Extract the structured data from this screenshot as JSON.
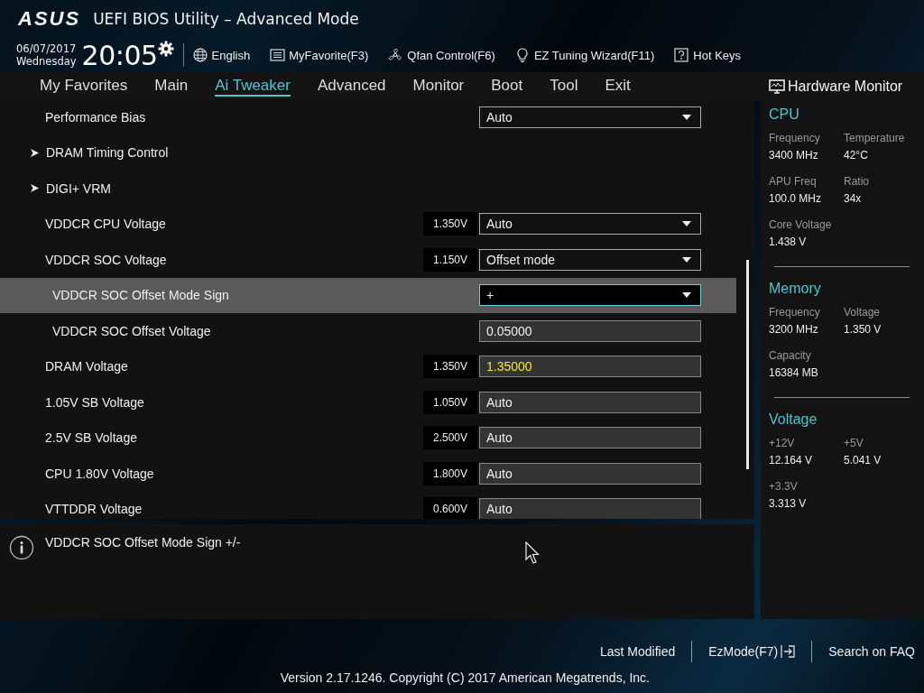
{
  "header": {
    "logo": "ASUS",
    "title": "UEFI BIOS Utility – Advanced Mode",
    "date": "06/07/2017",
    "weekday": "Wednesday",
    "time": "20:05",
    "tools": [
      {
        "kind": "language",
        "label": "English"
      },
      {
        "kind": "favorites",
        "label": "MyFavorite(F3)"
      },
      {
        "kind": "fan",
        "label": "Qfan Control(F6)"
      },
      {
        "kind": "wizard",
        "label": "EZ Tuning Wizard(F11)"
      },
      {
        "kind": "hotkeys",
        "label": "Hot Keys"
      }
    ]
  },
  "menu": [
    {
      "label": "My Favorites",
      "selected": false
    },
    {
      "label": "Main",
      "selected": false
    },
    {
      "label": "Ai Tweaker",
      "selected": true
    },
    {
      "label": "Advanced",
      "selected": false
    },
    {
      "label": "Monitor",
      "selected": false
    },
    {
      "label": "Boot",
      "selected": false
    },
    {
      "label": "Tool",
      "selected": false
    },
    {
      "label": "Exit",
      "selected": false
    }
  ],
  "settings": [
    {
      "kind": "dropdown",
      "label": "Performance Bias",
      "value": "Auto",
      "selected": false
    },
    {
      "kind": "submenu",
      "label": "DRAM Timing Control"
    },
    {
      "kind": "submenu",
      "label": "DIGI+ VRM"
    },
    {
      "kind": "dropdown",
      "label": "VDDCR CPU Voltage",
      "reading": "1.350V",
      "value": "Auto",
      "selected": false
    },
    {
      "kind": "dropdown",
      "label": "VDDCR SOC Voltage",
      "reading": "1.150V",
      "value": "Offset mode",
      "selected": false,
      "children": [
        {
          "kind": "dropdown",
          "label": "VDDCR SOC Offset Mode Sign",
          "value": "+",
          "selected": true
        },
        {
          "kind": "field",
          "label": "VDDCR SOC Offset Voltage",
          "value": "0.05000",
          "modified": false,
          "selected": false
        }
      ]
    },
    {
      "kind": "field",
      "label": "DRAM Voltage",
      "reading": "1.350V",
      "value": "1.35000",
      "modified": true,
      "selected": false
    },
    {
      "kind": "field",
      "label": "1.05V SB Voltage",
      "reading": "1.050V",
      "value": "Auto",
      "modified": false,
      "selected": false
    },
    {
      "kind": "field",
      "label": "2.5V SB Voltage",
      "reading": "2.500V",
      "value": "Auto",
      "modified": false,
      "selected": false
    },
    {
      "kind": "field",
      "label": "CPU 1.80V Voltage",
      "reading": "1.800V",
      "value": "Auto",
      "modified": false,
      "selected": false
    },
    {
      "kind": "field",
      "label": "VTTDDR Voltage",
      "reading": "0.600V",
      "value": "Auto",
      "modified": false,
      "selected": false
    }
  ],
  "help": "VDDCR SOC Offset Mode Sign +/-",
  "hardware_monitor": {
    "title": "Hardware Monitor",
    "sections": [
      {
        "title": "CPU",
        "items": [
          {
            "label": "Frequency",
            "value": "3400 MHz"
          },
          {
            "label": "Temperature",
            "value": "42°C"
          },
          {
            "label": "APU Freq",
            "value": "100.0 MHz"
          },
          {
            "label": "Ratio",
            "value": "34x"
          },
          {
            "label": "Core Voltage",
            "value": "1.438 V"
          }
        ]
      },
      {
        "title": "Memory",
        "items": [
          {
            "label": "Frequency",
            "value": "3200 MHz"
          },
          {
            "label": "Voltage",
            "value": "1.350 V"
          },
          {
            "label": "Capacity",
            "value": "16384 MB"
          }
        ]
      },
      {
        "title": "Voltage",
        "items": [
          {
            "label": "+12V",
            "value": "12.164 V"
          },
          {
            "label": "+5V",
            "value": "5.041 V"
          },
          {
            "label": "+3.3V",
            "value": "3.313 V"
          }
        ]
      }
    ]
  },
  "footer": {
    "links": [
      "Last Modified",
      "EzMode(F7)",
      "Search on FAQ"
    ],
    "version": "Version 2.17.1246. Copyright (C) 2017 American Megatrends, Inc."
  }
}
